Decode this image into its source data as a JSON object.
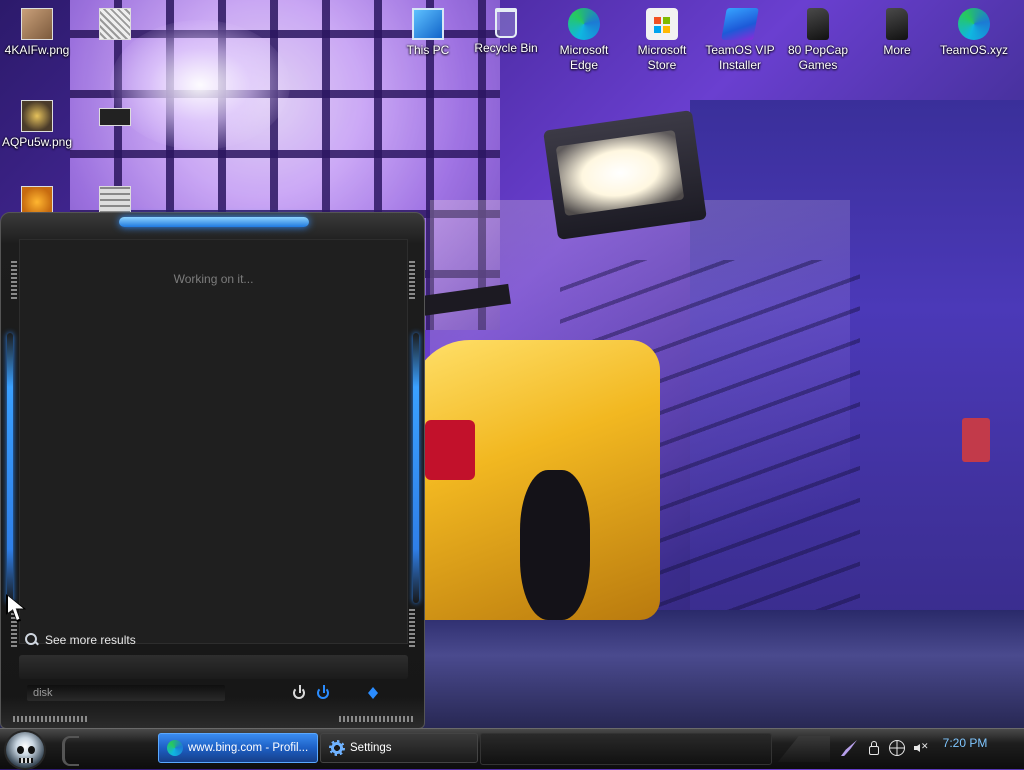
{
  "desktop": {
    "icons": [
      {
        "name": "file-4kaifw",
        "label": "4KAIFw.png",
        "icon": "image-thumbnail-icon"
      },
      {
        "name": "file-image-2",
        "label": "",
        "icon": "image-thumbnail-icon"
      },
      {
        "name": "file-aqpu5w",
        "label": "AQPu5w.png",
        "icon": "image-thumbnail-icon"
      },
      {
        "name": "file-image-4",
        "label": "",
        "icon": "image-thumbnail-icon"
      },
      {
        "name": "file-image-5",
        "label": "",
        "icon": "image-thumbnail-icon"
      },
      {
        "name": "file-image-6",
        "label": "",
        "icon": "image-thumbnail-icon"
      },
      {
        "name": "this-pc",
        "label": "This PC",
        "icon": "computer-icon"
      },
      {
        "name": "recycle-bin",
        "label": "Recycle Bin",
        "icon": "recycle-bin-icon"
      },
      {
        "name": "microsoft-edge",
        "label": "Microsoft Edge",
        "icon": "edge-browser-icon"
      },
      {
        "name": "microsoft-store",
        "label": "Microsoft Store",
        "icon": "store-icon"
      },
      {
        "name": "teamos-vip-installer",
        "label": "TeamOS VIP Installer",
        "icon": "installer-icon"
      },
      {
        "name": "popcap-games",
        "label": "80 PopCap Games",
        "icon": "folder-icon"
      },
      {
        "name": "more",
        "label": "More",
        "icon": "folder-icon"
      },
      {
        "name": "teamos-xyz",
        "label": "TeamOS.xyz",
        "icon": "edge-browser-icon"
      }
    ]
  },
  "start_menu": {
    "status_text": "Working on it...",
    "see_more_results": "See more results",
    "search_value": "disk"
  },
  "taskbar": {
    "buttons": [
      {
        "label": "www.bing.com - Profil...",
        "icon": "edge-browser-icon",
        "active": true
      },
      {
        "label": "Settings",
        "icon": "gear-icon",
        "active": false
      }
    ],
    "clock": "7:20 PM"
  },
  "colors": {
    "accent_blue": "#2a8cff",
    "taskbar_active": "#1d5fc4",
    "clock_text": "#7fc6ff"
  }
}
